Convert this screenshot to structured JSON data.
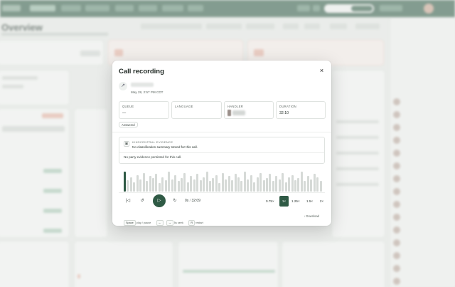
{
  "modal": {
    "title": "Call recording",
    "close_icon": "×",
    "caller_icon": "↗",
    "call_time": "May 28, 2:57 PM CDT",
    "details": [
      {
        "label": "QUEUE",
        "value": "—"
      },
      {
        "label": "LANGUAGE",
        "value": ""
      },
      {
        "label": "HANDLER",
        "value": ""
      },
      {
        "label": "DURATION",
        "value": "32:10"
      }
    ],
    "status_chip": "Answered",
    "evidence": {
      "icon": "document-icon",
      "icon_glyph": "▣",
      "kicker": "KINSCENTRAL EVIDENCE",
      "summary": "No classification summary stored for this call.",
      "party": "No party evidence persisted for this call."
    },
    "waveform": {
      "played_fraction": 0.02,
      "bar_levels": [
        0.95,
        0.55,
        0.7,
        0.45,
        0.8,
        0.6,
        0.9,
        0.5,
        0.75,
        0.65,
        0.85,
        0.4,
        0.7,
        0.55,
        0.95,
        0.6,
        0.8,
        0.5,
        0.65,
        0.9,
        0.45,
        0.75,
        0.6,
        0.85,
        0.55,
        0.7,
        0.95,
        0.5,
        0.65,
        0.8,
        0.4,
        0.9,
        0.6,
        0.75,
        0.55,
        0.85,
        0.7,
        0.5,
        0.95,
        0.6,
        0.8,
        0.45,
        0.7,
        0.9,
        0.55,
        0.65,
        0.85,
        0.5,
        0.75,
        0.6,
        0.9,
        0.45,
        0.7,
        0.8,
        0.55,
        0.65,
        0.95,
        0.5,
        0.75,
        0.6,
        0.85,
        0.7,
        0.5
      ]
    },
    "player": {
      "skip_start_icon": "|◁",
      "rewind_icon": "↺",
      "play_icon": "▷",
      "forward_icon": "↻",
      "time_current": "0s",
      "time_separator": "/",
      "time_total": "32:09",
      "speeds": [
        "0.75×",
        "1×",
        "1.25×",
        "1.5×",
        "2×"
      ],
      "active_speed": "1×"
    },
    "footer": {
      "keys": [
        {
          "key": "Space",
          "hint": "play / pause"
        },
        {
          "key": "←",
          "hint": ""
        },
        {
          "key": "→",
          "hint": "5s seek"
        },
        {
          "key": "R",
          "hint": "restart"
        }
      ],
      "download_label": "↓ Download"
    }
  },
  "background": {
    "page_title": "Overview"
  }
}
